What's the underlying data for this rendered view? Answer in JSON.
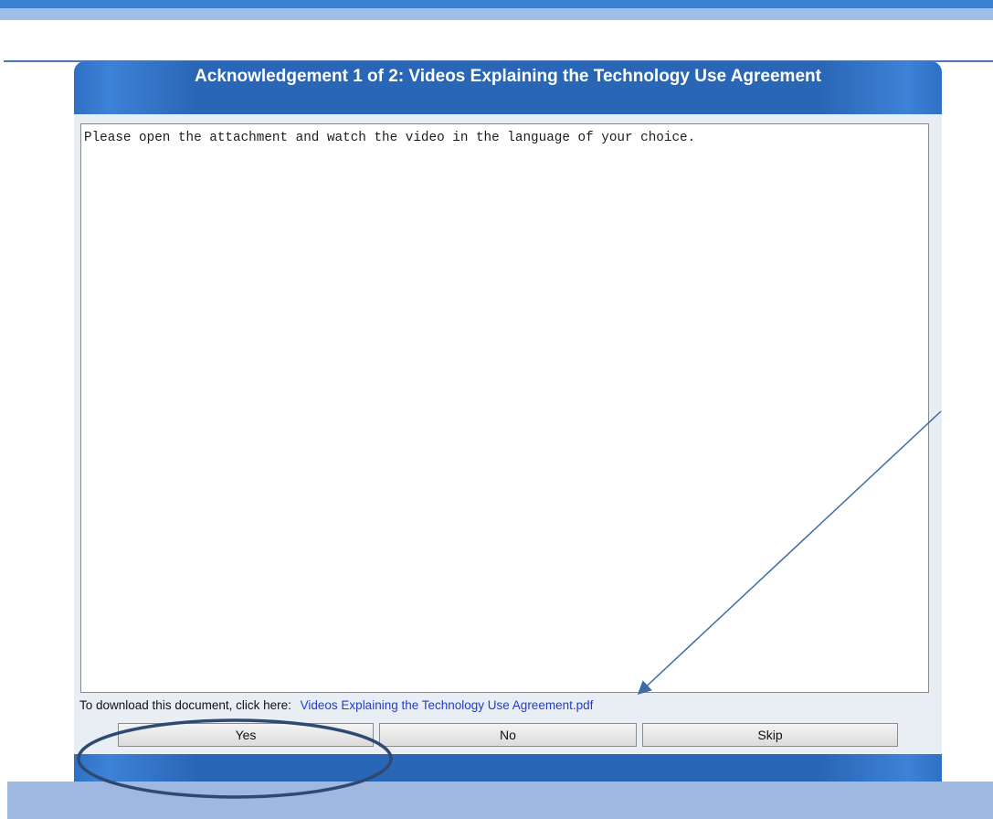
{
  "dialog": {
    "title": "Acknowledgement 1 of 2: Videos Explaining the Technology Use Agreement",
    "message": "Please open the attachment and watch the video in the language of your choice.",
    "download_prompt": "To download this document, click here:",
    "download_link": "Videos Explaining the Technology Use Agreement.pdf"
  },
  "buttons": {
    "yes": "Yes",
    "no": "No",
    "skip": "Skip"
  },
  "colors": {
    "header_blue": "#2a66b6",
    "link_blue": "#1f3ecc",
    "annotation_blue": "#3e6aa6"
  }
}
